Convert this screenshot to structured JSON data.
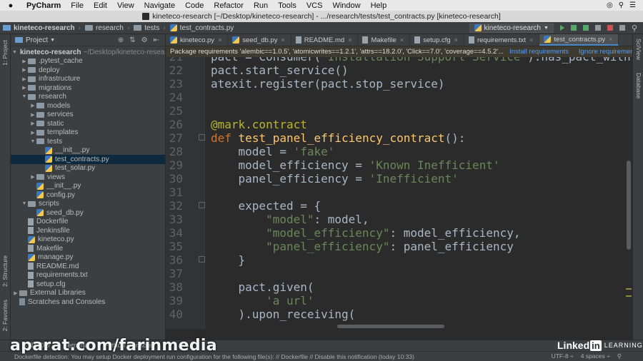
{
  "menubar": {
    "apple": "",
    "app_name": "PyCharm",
    "items": [
      "File",
      "Edit",
      "View",
      "Navigate",
      "Code",
      "Refactor",
      "Run",
      "Tools",
      "VCS",
      "Window",
      "Help"
    ]
  },
  "window": {
    "title": "kineteco-research [~/Desktop/kineteco-research] - .../research/tests/test_contracts.py [kineteco-research]"
  },
  "breadcrumb": [
    "kineteco-research",
    "research",
    "tests",
    "test_contracts.py"
  ],
  "run_config": {
    "label": "kineteco-research"
  },
  "project_panel": {
    "title": "Project",
    "root": {
      "name": "kineteco-research",
      "path": "~/Desktop/kineteco-research"
    },
    "items": [
      {
        "label": ".pytest_cache",
        "depth": 1,
        "type": "folder",
        "expanded": false
      },
      {
        "label": "deploy",
        "depth": 1,
        "type": "folder",
        "expanded": false
      },
      {
        "label": "infrastructure",
        "depth": 1,
        "type": "folder",
        "expanded": false
      },
      {
        "label": "migrations",
        "depth": 1,
        "type": "folder",
        "expanded": false
      },
      {
        "label": "research",
        "depth": 1,
        "type": "folder",
        "expanded": true
      },
      {
        "label": "models",
        "depth": 2,
        "type": "folder",
        "expanded": false
      },
      {
        "label": "services",
        "depth": 2,
        "type": "folder",
        "expanded": false
      },
      {
        "label": "static",
        "depth": 2,
        "type": "folder",
        "expanded": false
      },
      {
        "label": "templates",
        "depth": 2,
        "type": "folder",
        "expanded": false
      },
      {
        "label": "tests",
        "depth": 2,
        "type": "folder",
        "expanded": true
      },
      {
        "label": "__init__.py",
        "depth": 3,
        "type": "py"
      },
      {
        "label": "test_contracts.py",
        "depth": 3,
        "type": "py",
        "selected": true
      },
      {
        "label": "test_solar.py",
        "depth": 3,
        "type": "py"
      },
      {
        "label": "views",
        "depth": 2,
        "type": "folder",
        "expanded": false
      },
      {
        "label": "__init__.py",
        "depth": 2,
        "type": "py"
      },
      {
        "label": "config.py",
        "depth": 2,
        "type": "py"
      },
      {
        "label": "scripts",
        "depth": 1,
        "type": "folder",
        "expanded": true
      },
      {
        "label": "seed_db.py",
        "depth": 2,
        "type": "py"
      },
      {
        "label": "Dockerfile",
        "depth": 1,
        "type": "file"
      },
      {
        "label": "Jenkinsfile",
        "depth": 1,
        "type": "file"
      },
      {
        "label": "kineteco.py",
        "depth": 1,
        "type": "py"
      },
      {
        "label": "Makefile",
        "depth": 1,
        "type": "file"
      },
      {
        "label": "manage.py",
        "depth": 1,
        "type": "py"
      },
      {
        "label": "README.md",
        "depth": 1,
        "type": "file"
      },
      {
        "label": "requirements.txt",
        "depth": 1,
        "type": "file"
      },
      {
        "label": "setup.cfg",
        "depth": 1,
        "type": "file"
      },
      {
        "label": "External Libraries",
        "depth": 0,
        "type": "lib",
        "expanded": false
      },
      {
        "label": "Scratches and Consoles",
        "depth": 0,
        "type": "scratch"
      }
    ]
  },
  "tabs": [
    {
      "label": "kineteco.py",
      "active": false
    },
    {
      "label": "seed_db.py",
      "active": false
    },
    {
      "label": "README.md",
      "active": false
    },
    {
      "label": "Makefile",
      "active": false
    },
    {
      "label": "setup.cfg",
      "active": false
    },
    {
      "label": "requirements.txt",
      "active": false
    },
    {
      "label": "test_contracts.py",
      "active": true
    }
  ],
  "banner": {
    "message": "Package requirements 'alembic==1.0.5', 'atomicwrites==1.2.1', 'attrs==18.2.0', 'Click==7.0', 'coverage==4.5.2'...",
    "install_label": "Install requirements",
    "ignore_label": "Ignore requirements"
  },
  "code_lines": [
    {
      "n": "21",
      "t": "pact = Consumer('Installation Support Service').has_pact_with(P"
    },
    {
      "n": "22",
      "t": "pact.start_service()"
    },
    {
      "n": "23",
      "t": "atexit.register(pact.stop_service)"
    },
    {
      "n": "24",
      "t": ""
    },
    {
      "n": "25",
      "t": ""
    },
    {
      "n": "26",
      "t": "@mark.contract"
    },
    {
      "n": "27",
      "t": "def test_panel_efficiency_contract():"
    },
    {
      "n": "28",
      "t": "    model = 'fake'"
    },
    {
      "n": "29",
      "t": "    model_efficiency = 'Known Inefficient'"
    },
    {
      "n": "30",
      "t": "    panel_efficiency = 'Inefficient'"
    },
    {
      "n": "31",
      "t": ""
    },
    {
      "n": "32",
      "t": "    expected = {"
    },
    {
      "n": "33",
      "t": "        \"model\": model,"
    },
    {
      "n": "34",
      "t": "        \"model_efficiency\": model_efficiency,"
    },
    {
      "n": "35",
      "t": "        \"panel_efficiency\": panel_efficiency"
    },
    {
      "n": "36",
      "t": "    }"
    },
    {
      "n": "37",
      "t": ""
    },
    {
      "n": "38",
      "t": "    pact.given("
    },
    {
      "n": "39",
      "t": "        'a url'"
    },
    {
      "n": "40",
      "t": "    ).upon_receiving("
    }
  ],
  "side_tools": {
    "left": [
      "1: Project",
      "2: Structure",
      "2: Favorites"
    ],
    "right": [
      "SciView",
      "Database"
    ]
  },
  "bottom_tools": [
    "6: TODO",
    "Terminal",
    "Python Console"
  ],
  "status_bar": {
    "message": "Dockerfile detection: You may setup Docker deployment run configuration for the following file(s): // Dockerfile // Disable this notification (today 10:33)",
    "encoding": "UTF-8 ÷",
    "indent": "4 spaces ÷"
  },
  "watermarks": {
    "aparat": "aparat.com/farinmedia",
    "linkedin": "Linked",
    "linkedin_in": "in",
    "learning": "LEARNING"
  }
}
